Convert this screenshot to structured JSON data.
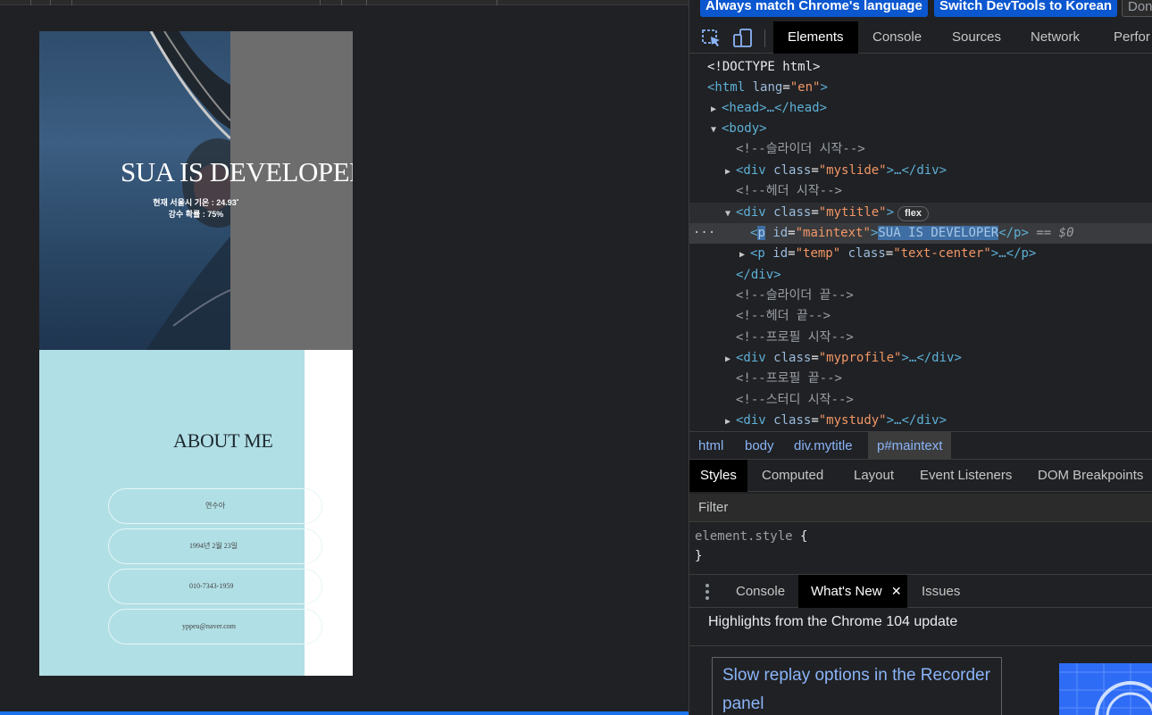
{
  "page": {
    "hero": {
      "title": "SUA IS DEVELOPER",
      "temp_line1": "현재 서울시 기온 : 24.93˚",
      "temp_line2": "강수 확률 : 75%"
    },
    "profile": {
      "heading": "ABOUT ME",
      "items": [
        "연수아",
        "1994년 2월 23일",
        "010-7343-1959",
        "yppeu@naver.com"
      ]
    }
  },
  "devtools": {
    "infobar": {
      "btn1": "Always match Chrome's language",
      "btn2": "Switch DevTools to Korean",
      "btn3": "Don"
    },
    "tabs": [
      "Elements",
      "Console",
      "Sources",
      "Network",
      "Perfor"
    ],
    "active_tab": "Elements",
    "dom": {
      "doctype": "<!DOCTYPE html>",
      "html_open": "<html",
      "html_attr": "lang",
      "html_val": "\"en\"",
      "head": "<head>…</head>",
      "body": "<body>",
      "c1": "<!--슬라이더 시작-->",
      "myslide_tag": "<div",
      "myslide_attr": "class",
      "myslide_val": "\"myslide\"",
      "myslide_end": ">…</div>",
      "c2": "<!--헤더 시작-->",
      "mytitle_val": "\"mytitle\"",
      "flex": "flex",
      "p_id": "id",
      "maintext_val": "\"maintext\"",
      "maintext_text": "SUA IS DEVELOPER",
      "p_close": "</p>",
      "eq": "== $0",
      "temp_val": "\"temp\"",
      "textcenter_val": "\"text-center\"",
      "div_close": "</div>",
      "c3": "<!--슬라이더 끝-->",
      "c4": "<!--헤더 끝-->",
      "c5": "<!--프로필 시작-->",
      "myprofile_val": "\"myprofile\"",
      "c6": "<!--프로필 끝-->",
      "c7": "<!--스터디 시작-->",
      "mystudy_val": "\"mystudy\""
    },
    "breadcrumbs": [
      "html",
      "body",
      "div.mytitle",
      "p#maintext"
    ],
    "subtabs": [
      "Styles",
      "Computed",
      "Layout",
      "Event Listeners",
      "DOM Breakpoints"
    ],
    "filter_placeholder": "Filter",
    "element_style": "element.style",
    "drawer_tabs": [
      "Console",
      "What's New",
      "Issues"
    ],
    "highlights": "Highlights from the Chrome 104 update",
    "card_title": "Slow replay options in the Recorder panel"
  },
  "colors": {
    "profile_bg": "#b0dfe5",
    "devtools_bg": "#202124",
    "accent": "#0b57d0"
  }
}
